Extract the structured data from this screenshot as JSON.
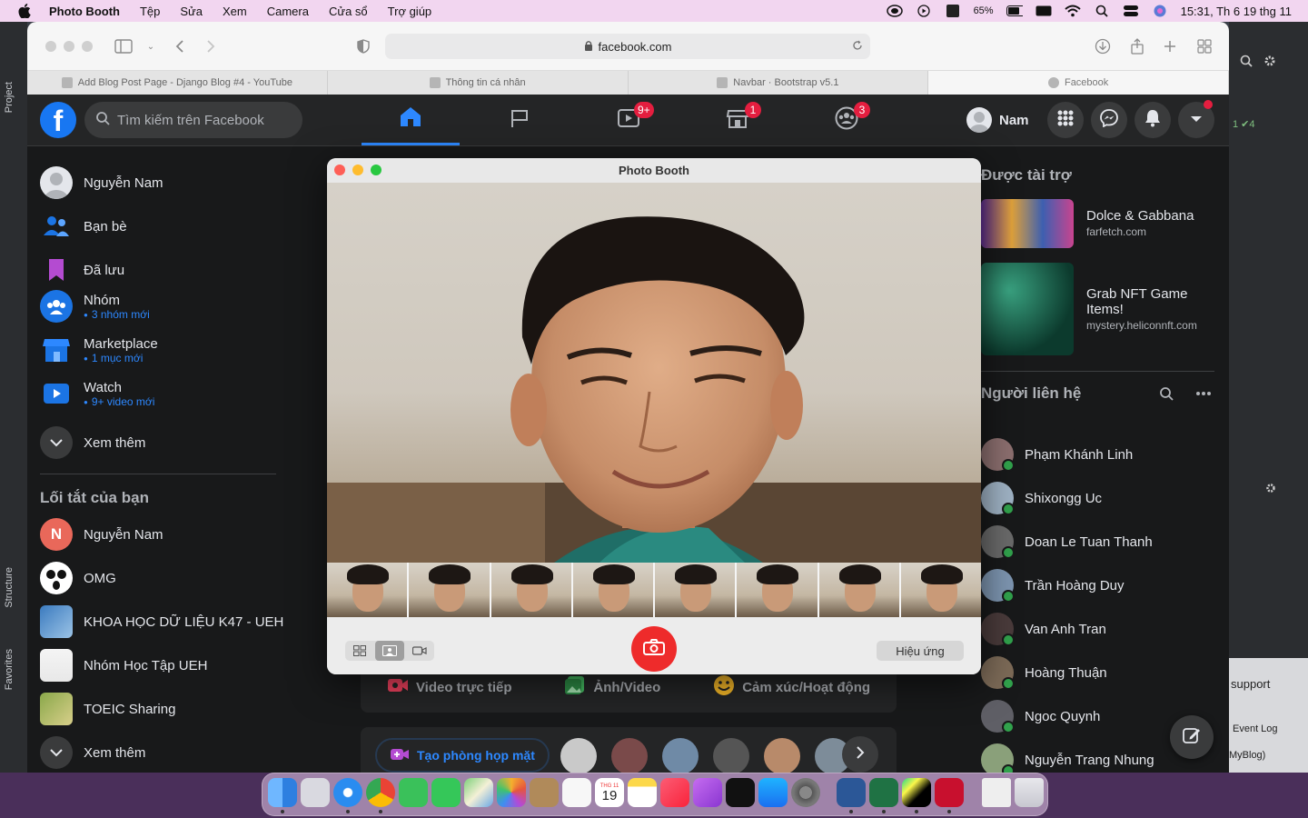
{
  "menubar": {
    "app_name": "Photo Booth",
    "menus": [
      "Tệp",
      "Sửa",
      "Xem",
      "Camera",
      "Cửa sổ",
      "Trợ giúp"
    ],
    "battery": "65%",
    "clock": "15:31, Th 6 19 thg 11"
  },
  "ide": {
    "left_labels": [
      "Project",
      "Structure",
      "Favorites"
    ],
    "right_labels": [
      "support",
      "Event Log",
      "MyBlog)"
    ],
    "right_counts": "1  ✔4"
  },
  "safari": {
    "url": "facebook.com",
    "tabs": [
      {
        "title": "Add Blog Post Page - Django Blog #4 - YouTube"
      },
      {
        "title": "Thông tin cá nhân"
      },
      {
        "title": "Navbar · Bootstrap v5.1"
      },
      {
        "title": "Facebook"
      }
    ]
  },
  "facebook": {
    "search_placeholder": "Tìm kiếm trên Facebook",
    "nav_badges": {
      "watch": "9+",
      "marketplace": "1",
      "groups": "3"
    },
    "profile_name": "Nam",
    "sidebar": {
      "items": [
        {
          "label": "Nguyễn Nam"
        },
        {
          "label": "Bạn bè"
        },
        {
          "label": "Đã lưu"
        },
        {
          "label": "Nhóm",
          "sub": "3 nhóm mới"
        },
        {
          "label": "Marketplace",
          "sub": "1 mục mới"
        },
        {
          "label": "Watch",
          "sub": "9+ video mới"
        },
        {
          "label": "Xem thêm"
        }
      ],
      "shortcuts_title": "Lối tắt của bạn",
      "shortcuts": [
        {
          "label": "Nguyễn Nam",
          "initial": "N"
        },
        {
          "label": "OMG"
        },
        {
          "label": "KHOA HỌC DỮ LIỆU K47 - UEH"
        },
        {
          "label": "Nhóm Học Tập UEH"
        },
        {
          "label": "TOEIC Sharing"
        },
        {
          "label": "Xem thêm"
        }
      ]
    },
    "composer_actions": [
      {
        "label": "Video trực tiếp",
        "color": "#f3425f"
      },
      {
        "label": "Ảnh/Video",
        "color": "#45bd62"
      },
      {
        "label": "Cảm xúc/Hoạt động",
        "color": "#f7b928"
      }
    ],
    "create_room": "Tạo phòng họp mặt",
    "sponsored_title": "Được tài trợ",
    "ads": [
      {
        "name": "Dolce & Gabbana",
        "domain": "farfetch.com"
      },
      {
        "name": "Grab NFT Game Items!",
        "domain": "mystery.heliconnft.com"
      }
    ],
    "contacts_title": "Người liên hệ",
    "contacts": [
      {
        "name": "Phạm Khánh Linh"
      },
      {
        "name": "Shixongg Uc"
      },
      {
        "name": "Doan Le Tuan Thanh"
      },
      {
        "name": "Trần Hoàng Duy"
      },
      {
        "name": "Van Anh Tran"
      },
      {
        "name": "Hoàng Thuận"
      },
      {
        "name": "Ngoc Quynh"
      },
      {
        "name": "Nguyễn Trang Nhung"
      }
    ],
    "accent": "#2d88ff"
  },
  "photobooth": {
    "title": "Photo Booth",
    "effects_label": "Hiệu ứng",
    "thumbnail_count": 8
  },
  "dock": {
    "calendar_month": "THG 11",
    "calendar_day": "19"
  }
}
